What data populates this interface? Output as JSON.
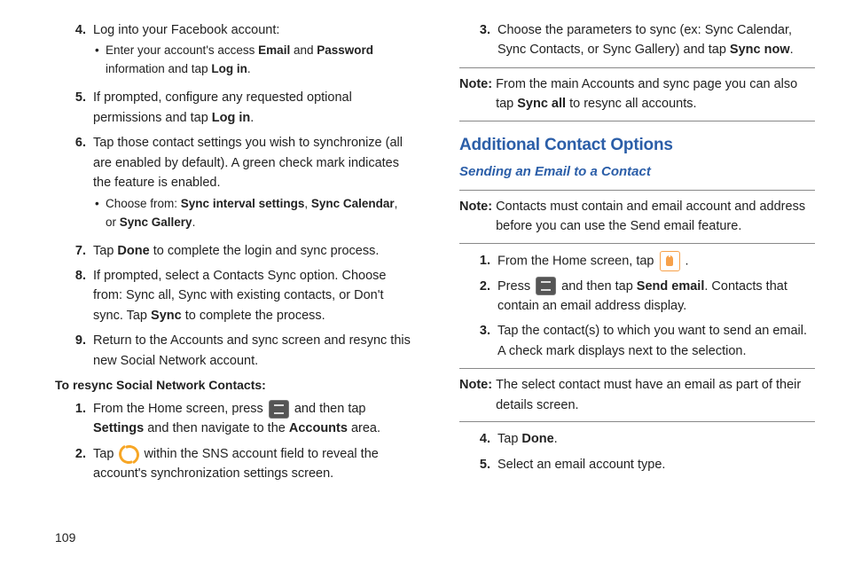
{
  "left": {
    "items": [
      {
        "num": "4.",
        "text": "Log into your Facebook account:",
        "bullets": [
          {
            "pre": "Enter your account's access ",
            "b1": "Email",
            "mid1": " and ",
            "b2": "Password",
            "mid2": " information and tap ",
            "b3": "Log in",
            "post": "."
          }
        ]
      },
      {
        "num": "5.",
        "parts": [
          {
            "t": "If prompted, configure any requested optional permissions and tap "
          },
          {
            "b": "Log in"
          },
          {
            "t": "."
          }
        ]
      },
      {
        "num": "6.",
        "parts": [
          {
            "t": "Tap those contact settings you wish to synchronize (all are enabled by default). A green check mark indicates the feature is enabled."
          }
        ],
        "bullets": [
          {
            "pre": "Choose from: ",
            "b1": "Sync interval settings",
            "mid1": ", ",
            "b2": "Sync Calendar",
            "mid2": ", or ",
            "b3": "Sync Gallery",
            "post": "."
          }
        ]
      },
      {
        "num": "7.",
        "parts": [
          {
            "t": "Tap "
          },
          {
            "b": "Done"
          },
          {
            "t": " to complete the login and sync process."
          }
        ]
      },
      {
        "num": "8.",
        "parts": [
          {
            "t": "If prompted, select a Contacts Sync option. Choose from: Sync all, Sync with existing contacts, or Don't sync. Tap "
          },
          {
            "b": "Sync"
          },
          {
            "t": " to complete the process."
          }
        ]
      },
      {
        "num": "9.",
        "parts": [
          {
            "t": "Return to the Accounts and sync screen and resync this new Social Network account."
          }
        ]
      }
    ],
    "subhead": "To resync Social Network Contacts:",
    "resync": [
      {
        "num": "1.",
        "parts": [
          {
            "t": "From the Home screen, press "
          },
          {
            "icon": "menu"
          },
          {
            "t": " and then tap "
          },
          {
            "b": "Settings"
          },
          {
            "t": " and then navigate to the "
          },
          {
            "b": "Accounts"
          },
          {
            "t": " area."
          }
        ]
      },
      {
        "num": "2.",
        "parts": [
          {
            "t": "Tap "
          },
          {
            "icon": "sync"
          },
          {
            "t": " within the SNS account field to reveal the account's synchronization settings screen."
          }
        ]
      }
    ]
  },
  "right": {
    "items3": {
      "num": "3.",
      "parts": [
        {
          "t": "Choose the parameters to sync (ex: Sync Calendar, Sync Contacts, or Sync Gallery) and tap "
        },
        {
          "b": "Sync now"
        },
        {
          "t": "."
        }
      ]
    },
    "note1": {
      "label": "Note:",
      "parts": [
        {
          "t": "From the main Accounts and sync page you can also tap "
        },
        {
          "b": "Sync all"
        },
        {
          "t": " to resync all accounts."
        }
      ]
    },
    "h1": "Additional Contact Options",
    "h2": "Sending an Email to a Contact",
    "note2": {
      "label": "Note:",
      "text": "Contacts must contain and email account and address before you can use the Send email feature."
    },
    "email": [
      {
        "num": "1.",
        "parts": [
          {
            "t": "From the Home screen, tap "
          },
          {
            "icon": "app"
          },
          {
            "t": " ."
          }
        ]
      },
      {
        "num": "2.",
        "parts": [
          {
            "t": "Press "
          },
          {
            "icon": "menu"
          },
          {
            "t": " and then tap "
          },
          {
            "b": "Send email"
          },
          {
            "t": ". Contacts that contain an email address display."
          }
        ]
      },
      {
        "num": "3.",
        "parts": [
          {
            "t": "Tap the contact(s) to which you want to send an email. A check mark displays next to the selection."
          }
        ]
      }
    ],
    "note3": {
      "label": "Note:",
      "text": "The select contact must have an email as part of their details screen."
    },
    "email2": [
      {
        "num": "4.",
        "parts": [
          {
            "t": "Tap "
          },
          {
            "b": "Done"
          },
          {
            "t": "."
          }
        ]
      },
      {
        "num": "5.",
        "parts": [
          {
            "t": "Select an email account type."
          }
        ]
      }
    ]
  },
  "pageNum": "109"
}
